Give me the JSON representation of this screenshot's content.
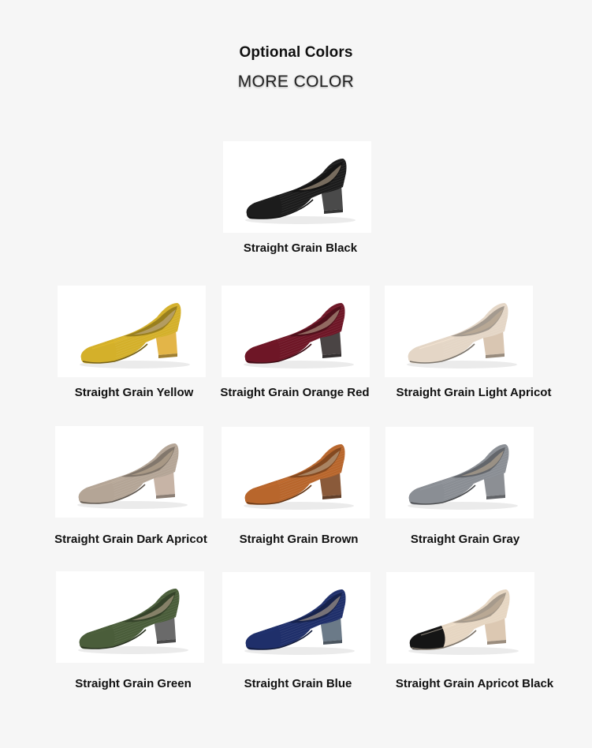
{
  "header": {
    "title": "Optional Colors",
    "subtitle": "MORE COLOR"
  },
  "products": [
    {
      "label": "Straight Grain Black",
      "upper": "#1c1c1c",
      "heel": "#4a4a4a",
      "toe": "#1c1c1c",
      "icon": "shoe-icon"
    },
    {
      "label": "Straight Grain Yellow",
      "upper": "#d4b02a",
      "heel": "#e3b548",
      "toe": "#d4b02a",
      "icon": "shoe-icon"
    },
    {
      "label": "Straight Grain Orange Red",
      "upper": "#6e1626",
      "heel": "#4a4444",
      "toe": "#6e1626",
      "icon": "shoe-icon"
    },
    {
      "label": "Straight Grain Light Apricot",
      "upper": "#e4d6c6",
      "heel": "#d9c6b2",
      "toe": "#e4d6c6",
      "icon": "shoe-icon"
    },
    {
      "label": "Straight Grain Dark Apricot",
      "upper": "#b4a596",
      "heel": "#c7b4a6",
      "toe": "#b4a596",
      "icon": "shoe-icon"
    },
    {
      "label": "Straight Grain Brown",
      "upper": "#b8662c",
      "heel": "#8a5a3a",
      "toe": "#b8662c",
      "icon": "shoe-icon"
    },
    {
      "label": "Straight Grain Gray",
      "upper": "#8a8e94",
      "heel": "#8c8f94",
      "toe": "#8a8e94",
      "icon": "shoe-icon"
    },
    {
      "label": "Straight Grain Green",
      "upper": "#4a5d3a",
      "heel": "#6a6a6a",
      "toe": "#4a5d3a",
      "icon": "shoe-icon"
    },
    {
      "label": "Straight Grain Blue",
      "upper": "#1f2f6a",
      "heel": "#6b7a88",
      "toe": "#1f2f6a",
      "icon": "shoe-icon"
    },
    {
      "label": "Straight Grain Apricot Black",
      "upper": "#e6d6c2",
      "heel": "#dcc8b2",
      "toe": "#151515",
      "icon": "shoe-icon"
    }
  ]
}
